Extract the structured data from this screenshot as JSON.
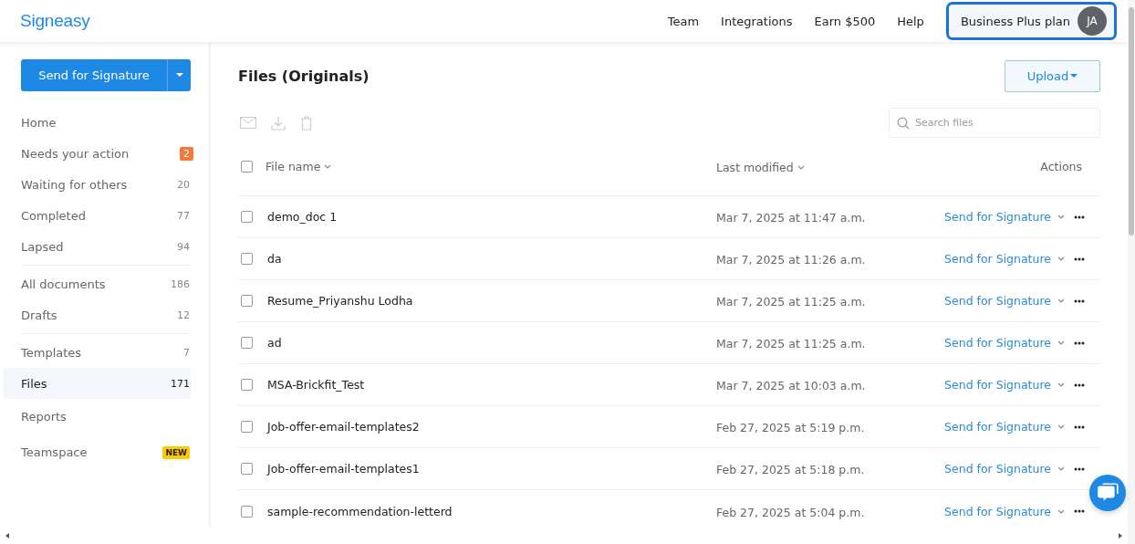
{
  "header": {
    "logo": "Signeasy",
    "nav": [
      "Team",
      "Integrations",
      "Earn $500",
      "Help"
    ],
    "plan": {
      "label": "Business Plus plan",
      "avatar": "JA",
      "selected": true
    }
  },
  "sidebar": {
    "primary_button": "Send for Signature",
    "groups": [
      [
        {
          "label": "Home",
          "selected": false
        },
        {
          "label": "Needs your action",
          "count": "2",
          "kind": "alert",
          "selected": false
        },
        {
          "label": "Waiting for others",
          "count": "20",
          "kind": "count",
          "selected": false
        },
        {
          "label": "Completed",
          "count": "77",
          "kind": "count",
          "selected": false
        },
        {
          "label": "Lapsed",
          "count": "94",
          "kind": "count",
          "selected": false
        }
      ],
      [
        {
          "label": "All documents",
          "count": "186",
          "kind": "count",
          "selected": false
        },
        {
          "label": "Drafts",
          "count": "12",
          "kind": "count",
          "selected": false
        }
      ],
      [
        {
          "label": "Templates",
          "count": "7",
          "kind": "count",
          "selected": false
        },
        {
          "label": "Files",
          "count": "171",
          "kind": "count",
          "selected": true
        },
        {
          "label": "Reports",
          "selected": false
        },
        {
          "label": "Teamspace",
          "count": "NEW",
          "kind": "new",
          "selected": false
        }
      ]
    ]
  },
  "main": {
    "title": "Files (Originals)",
    "upload_button": "Upload",
    "search": {
      "placeholder": "Search files"
    },
    "table": {
      "select_all_checked": false,
      "columns": [
        "File name",
        "Last modified",
        "Actions"
      ],
      "rows": [
        {
          "name": "demo_doc 1",
          "modified": "Mar 7, 2025 at 11:47 a.m.",
          "action": "Send for Signature",
          "checked": false
        },
        {
          "name": "da",
          "modified": "Mar 7, 2025 at 11:26 a.m.",
          "action": "Send for Signature",
          "checked": false
        },
        {
          "name": "Resume_Priyanshu Lodha",
          "modified": "Mar 7, 2025 at 11:25 a.m.",
          "action": "Send for Signature",
          "checked": false
        },
        {
          "name": "ad",
          "modified": "Mar 7, 2025 at 11:25 a.m.",
          "action": "Send for Signature",
          "checked": false
        },
        {
          "name": "MSA-Brickfit_Test",
          "modified": "Mar 7, 2025 at 10:03 a.m.",
          "action": "Send for Signature",
          "checked": false
        },
        {
          "name": "Job-offer-email-templates2",
          "modified": "Feb 27, 2025 at 5:19 p.m.",
          "action": "Send for Signature",
          "checked": false
        },
        {
          "name": "Job-offer-email-templates1",
          "modified": "Feb 27, 2025 at 5:18 p.m.",
          "action": "Send for Signature",
          "checked": false
        },
        {
          "name": "sample-recommendation-letterd",
          "modified": "Feb 27, 2025 at 5:04 p.m.",
          "action": "Send for Signature",
          "checked": false
        }
      ]
    }
  }
}
